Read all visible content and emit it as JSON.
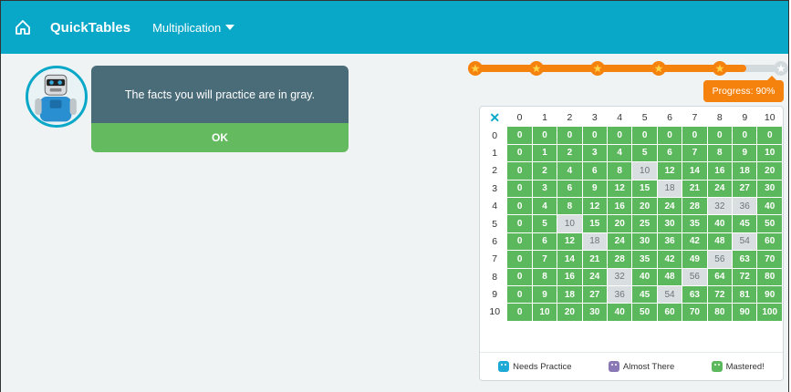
{
  "header": {
    "home_icon": "home-icon",
    "brand": "QuickTables",
    "menu_label": "Multiplication"
  },
  "message": {
    "text": "The facts you will practice are in gray.",
    "ok_label": "OK"
  },
  "progress": {
    "value_percent": 90,
    "label": "Progress: 90%",
    "star_count": 6,
    "stars_earned": 5
  },
  "table": {
    "corner": "✕",
    "columns": [
      "0",
      "1",
      "2",
      "3",
      "4",
      "5",
      "6",
      "7",
      "8",
      "9",
      "10"
    ],
    "rows": [
      "0",
      "1",
      "2",
      "3",
      "4",
      "5",
      "6",
      "7",
      "8",
      "9",
      "10"
    ],
    "practice_cells": [
      [
        2,
        5
      ],
      [
        3,
        6
      ],
      [
        4,
        8
      ],
      [
        4,
        9
      ],
      [
        5,
        2
      ],
      [
        6,
        3
      ],
      [
        6,
        9
      ],
      [
        7,
        8
      ],
      [
        8,
        4
      ],
      [
        8,
        7
      ],
      [
        9,
        4
      ],
      [
        9,
        6
      ]
    ],
    "colors": {
      "mastered": "#5cb85c",
      "practice": "#d9dee0",
      "corner": "#0aa8c8"
    }
  },
  "legend": {
    "needs_practice": "Needs Practice",
    "almost_there": "Almost There",
    "mastered": "Mastered!"
  },
  "colors": {
    "topbar": "#0aa8c8",
    "accent": "#f5820d",
    "dialog": "#4a6b78",
    "ok": "#64bb5f"
  }
}
